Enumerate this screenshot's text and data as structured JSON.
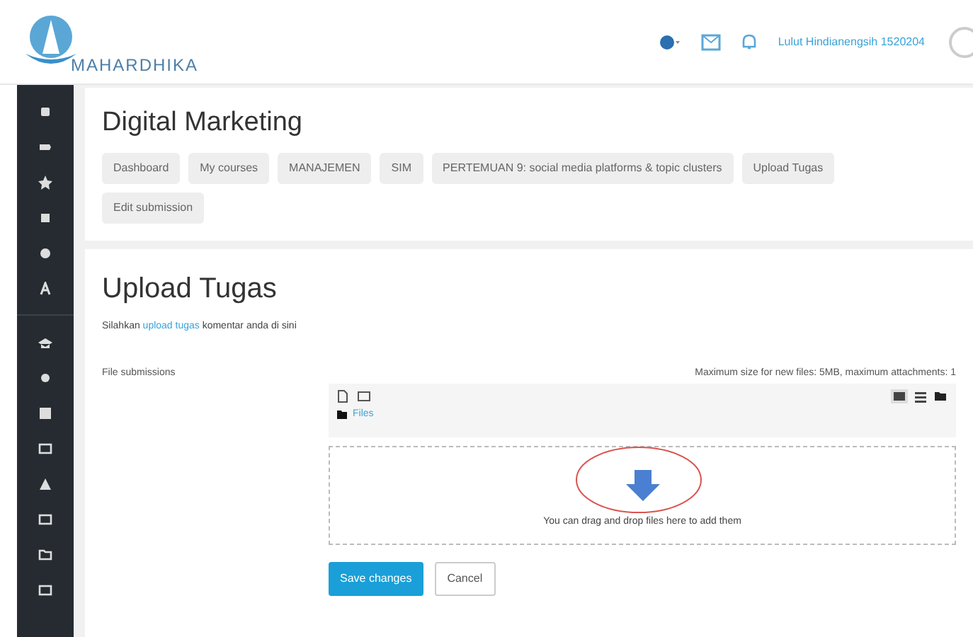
{
  "header": {
    "logo_text": "MAHARDHIKA",
    "user_name": "Lulut Hindianengsih 1520204"
  },
  "course": {
    "title": "Digital Marketing",
    "breadcrumbs": [
      "Dashboard",
      "My courses",
      "MANAJEMEN",
      "SIM",
      "PERTEMUAN 9: social media platforms & topic clusters",
      "Upload Tugas",
      "Edit submission"
    ]
  },
  "assignment": {
    "title": "Upload Tugas",
    "description_before": "Silahkan",
    "link_text": "upload tugas",
    "description_after": "komentar anda di sini"
  },
  "form": {
    "label": "File submissions",
    "limit_note": "Maximum size for new files: 5MB, maximum attachments: 1",
    "folder": "Files",
    "drop_hint": "You can drag and drop files here to add them",
    "buttons": [
      {
        "label": "Save changes",
        "kind": "primary"
      },
      {
        "label": "Cancel",
        "kind": "secondary"
      }
    ]
  }
}
